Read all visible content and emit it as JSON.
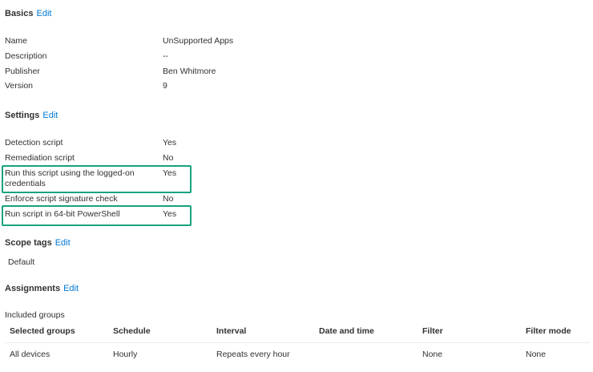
{
  "basics": {
    "title": "Basics",
    "edit": "Edit",
    "rows": [
      {
        "label": "Name",
        "value": "UnSupported Apps"
      },
      {
        "label": "Description",
        "value": "--"
      },
      {
        "label": "Publisher",
        "value": "Ben Whitmore"
      },
      {
        "label": "Version",
        "value": "9"
      }
    ]
  },
  "settings": {
    "title": "Settings",
    "edit": "Edit",
    "rows": [
      {
        "label": "Detection script",
        "value": "Yes"
      },
      {
        "label": "Remediation script",
        "value": "No"
      },
      {
        "label": "Run this script using the logged-on credentials",
        "value": "Yes"
      },
      {
        "label": "Enforce script signature check",
        "value": "No"
      },
      {
        "label": "Run script in 64-bit PowerShell",
        "value": "Yes"
      }
    ],
    "highlight_color": "#17a37f"
  },
  "scope_tags": {
    "title": "Scope tags",
    "edit": "Edit",
    "value": "Default"
  },
  "assignments": {
    "title": "Assignments",
    "edit": "Edit",
    "included_label": "Included groups",
    "columns": [
      "Selected groups",
      "Schedule",
      "Interval",
      "Date and time",
      "Filter",
      "Filter mode"
    ],
    "rows": [
      [
        "All devices",
        "Hourly",
        "Repeats every hour",
        "",
        "None",
        "None"
      ]
    ]
  },
  "link_color": "#0078d4"
}
